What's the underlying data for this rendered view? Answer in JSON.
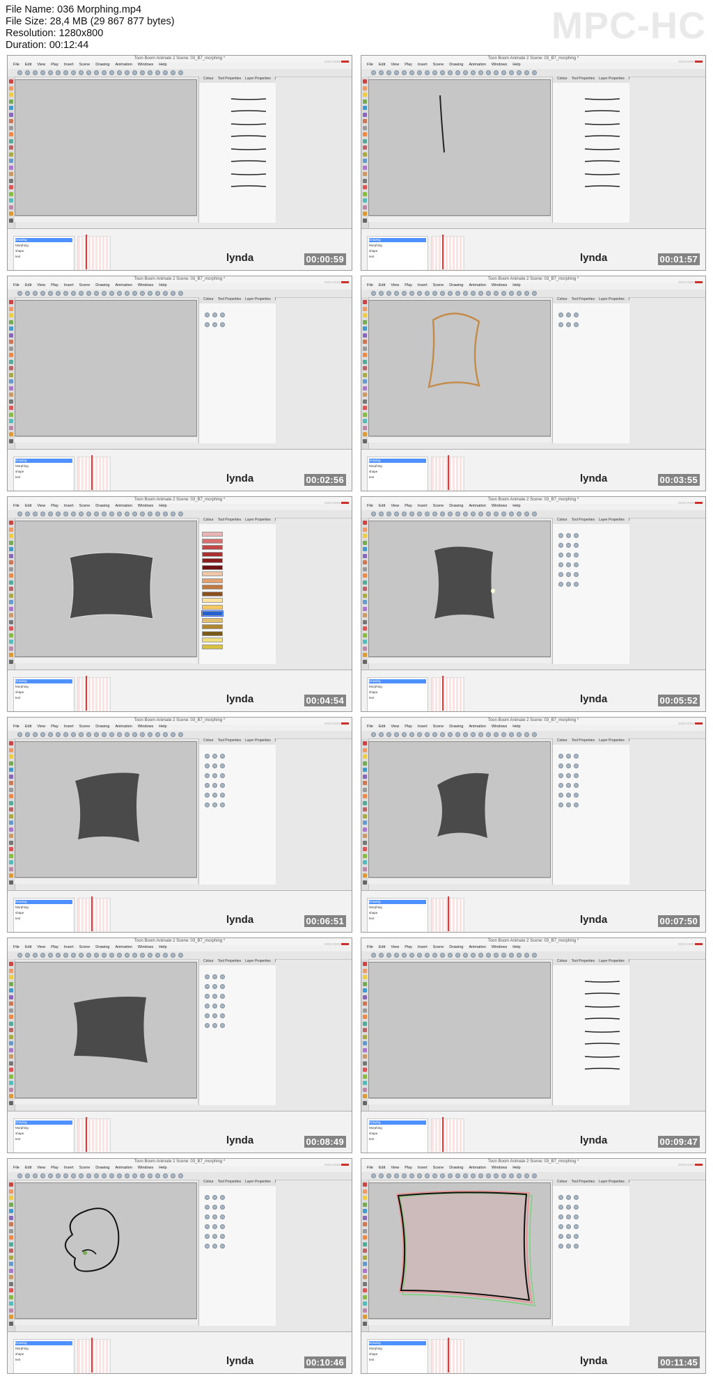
{
  "header": {
    "file_name": "File Name: 036 Morphing.mp4",
    "file_size": "File Size: 28,4 MB (29 867 877 bytes)",
    "resolution": "Resolution: 1280x800",
    "duration": "Duration: 00:12:44",
    "brand": "MPC-HC"
  },
  "watermark": "lynda",
  "app": {
    "window_title": "Toon Boom Animate 2 Scene: 03_B7_morphing *",
    "menu": [
      "File",
      "Edit",
      "View",
      "Play",
      "Insert",
      "Scene",
      "Drawing",
      "Animation",
      "Windows",
      "Help"
    ],
    "right_tabs": [
      "Colour",
      "Tool Properties",
      "Layer Properties",
      "Library"
    ],
    "layers": [
      "Drawing",
      "Morphing",
      "shape",
      "text"
    ]
  },
  "frames": [
    {
      "time": "00:00:59",
      "panel": "pencil",
      "shape": "none"
    },
    {
      "time": "00:01:57",
      "panel": "pencil",
      "shape": "line"
    },
    {
      "time": "00:02:56",
      "panel": "contour",
      "shape": "none"
    },
    {
      "time": "00:03:55",
      "panel": "contour",
      "shape": "outline"
    },
    {
      "time": "00:04:54",
      "panel": "palette",
      "shape": "flagA"
    },
    {
      "time": "00:05:52",
      "panel": "morph",
      "shape": "flagB"
    },
    {
      "time": "00:06:51",
      "panel": "morph",
      "shape": "flagC"
    },
    {
      "time": "00:07:50",
      "panel": "morph",
      "shape": "flagD"
    },
    {
      "time": "00:08:49",
      "panel": "morph",
      "shape": "flagE"
    },
    {
      "time": "00:09:47",
      "panel": "pencil",
      "shape": "none"
    },
    {
      "time": "00:10:46",
      "panel": "tools",
      "shape": "face"
    },
    {
      "time": "00:11:45",
      "panel": "morph",
      "shape": "onion"
    }
  ]
}
